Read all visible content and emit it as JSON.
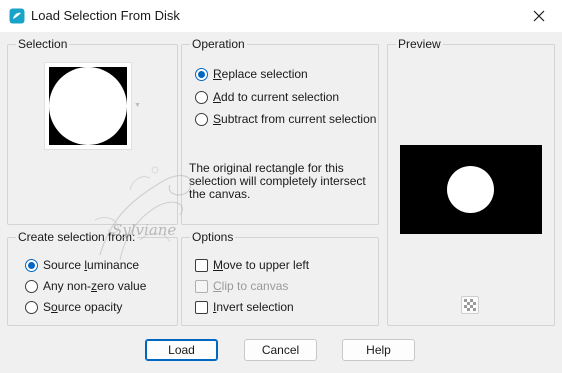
{
  "window": {
    "title": "Load Selection From Disk",
    "app_icon": "paint-shop-icon",
    "close_icon": "close-icon"
  },
  "selection_group": {
    "label": "Selection"
  },
  "operation_group": {
    "label": "Operation",
    "options": [
      {
        "pre": "",
        "key": "R",
        "post": "eplace selection",
        "checked": true
      },
      {
        "pre": "",
        "key": "A",
        "post": "dd to current selection",
        "checked": false
      },
      {
        "pre": "",
        "key": "S",
        "post": "ubtract from current selection",
        "checked": false
      }
    ],
    "info": "The original rectangle for this selection will completely intersect the canvas."
  },
  "preview_group": {
    "label": "Preview",
    "toggle_icon": "checkerboard-icon"
  },
  "create_group": {
    "label": "Create selection from:",
    "options": [
      {
        "pre": "Source ",
        "key": "l",
        "post": "uminance",
        "checked": true
      },
      {
        "pre": "Any non-",
        "key": "z",
        "post": "ero value",
        "checked": false
      },
      {
        "pre": "S",
        "key": "o",
        "post": "urce opacity",
        "checked": false
      }
    ]
  },
  "options_group": {
    "label": "Options",
    "items": [
      {
        "pre": "",
        "key": "M",
        "post": "ove to upper left",
        "checked": false,
        "disabled": false
      },
      {
        "pre": "",
        "key": "C",
        "post": "lip to canvas",
        "checked": false,
        "disabled": true
      },
      {
        "pre": "",
        "key": "I",
        "post": "nvert selection",
        "checked": false,
        "disabled": false
      }
    ]
  },
  "buttons": {
    "load": "Load",
    "cancel": "Cancel",
    "help": "Help"
  },
  "watermark": {
    "text": "Sylviane"
  },
  "colors": {
    "accent": "#0067c0",
    "preview_bg": "#000000",
    "selection_shape": "#ffffff"
  }
}
